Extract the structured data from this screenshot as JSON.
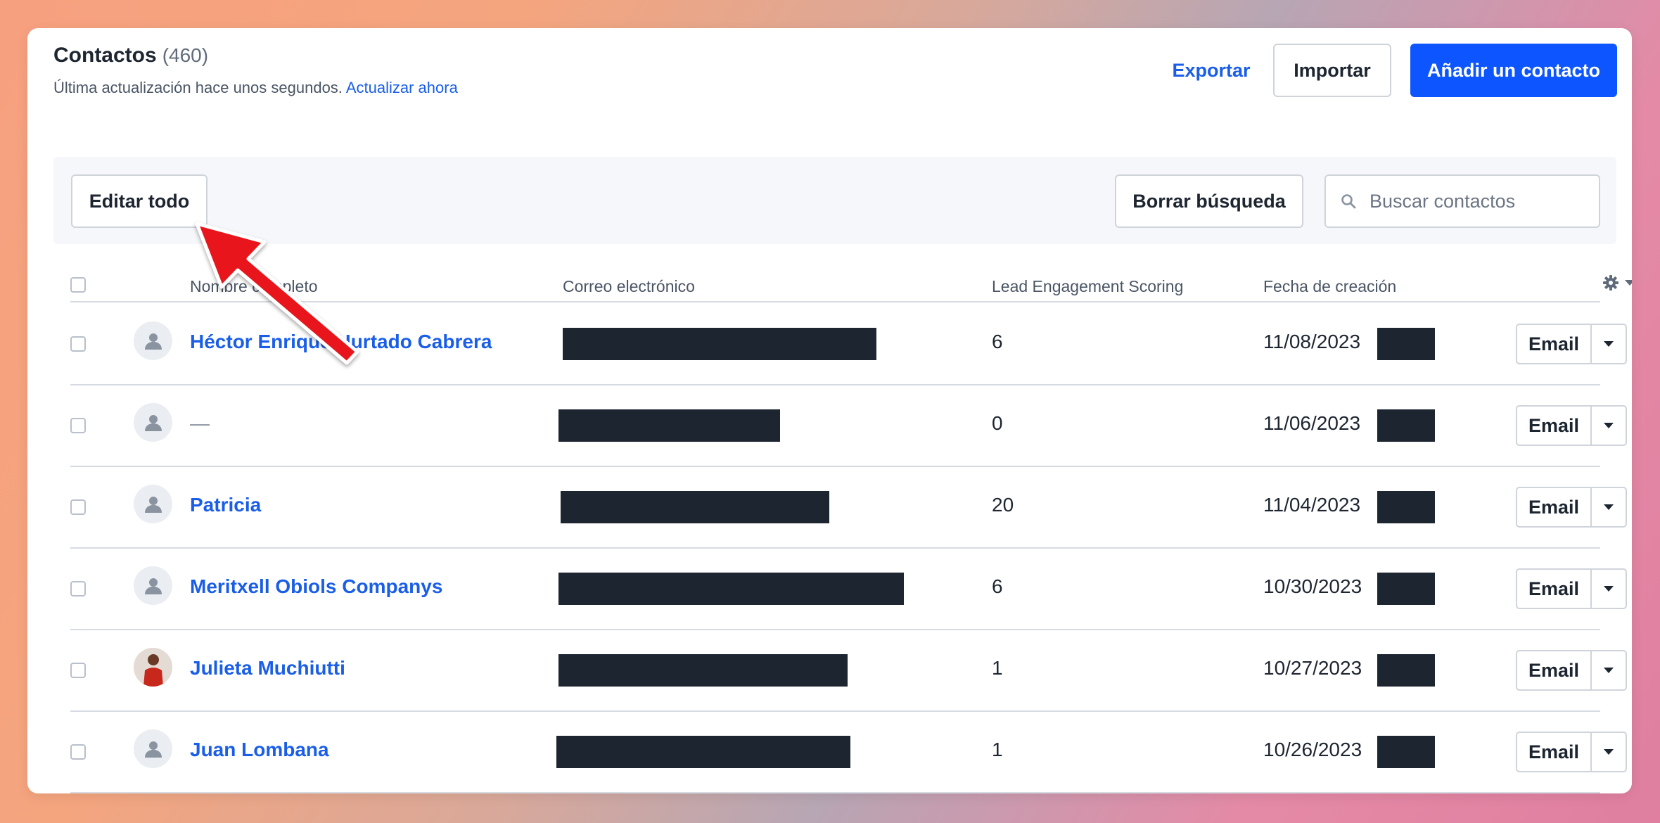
{
  "header": {
    "title": "Contactos",
    "count": "(460)",
    "subtitle": "Última actualización hace unos segundos.",
    "refresh_link": "Actualizar ahora",
    "export_label": "Exportar",
    "import_label": "Importar",
    "add_label": "Añadir un contacto"
  },
  "toolbar": {
    "edit_all_label": "Editar todo",
    "clear_search_label": "Borrar búsqueda",
    "search_placeholder": "Buscar contactos"
  },
  "table": {
    "columns": [
      "Nombre completo",
      "Correo electrónico",
      "Lead Engagement Scoring",
      "Fecha de creación"
    ],
    "action_label": "Email",
    "rows": [
      {
        "name": "Héctor Enrique Hurtado Cabrera",
        "score": "6",
        "date": "11/08/2023"
      },
      {
        "name": "—",
        "score": "0",
        "date": "11/06/2023"
      },
      {
        "name": "Patricia",
        "score": "20",
        "date": "11/04/2023"
      },
      {
        "name": "Meritxell Obiols Companys",
        "score": "6",
        "date": "10/30/2023"
      },
      {
        "name": "Julieta Muchiutti",
        "score": "1",
        "date": "10/27/2023"
      },
      {
        "name": "Juan Lombana",
        "score": "1",
        "date": "10/26/2023"
      }
    ]
  },
  "colors": {
    "accent": "#0d56ff",
    "link": "#1a5ee8",
    "annotation_arrow": "#e8191c",
    "redaction": "#1c2530"
  },
  "icons": [
    "search-icon",
    "gear-icon",
    "chevron-down-icon",
    "user-placeholder-icon",
    "arrow-annotation"
  ]
}
